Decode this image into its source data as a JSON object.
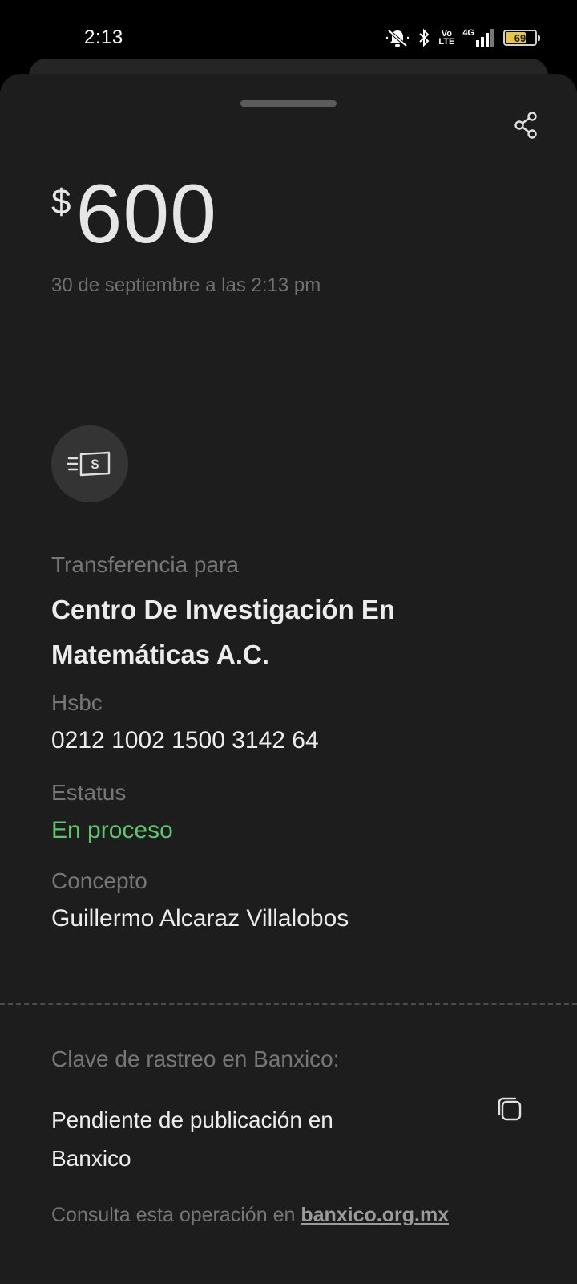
{
  "status_bar": {
    "time": "2:13",
    "network_top": "Vo",
    "network_bottom": "LTE",
    "network_type": "4G",
    "battery_level": "69",
    "icons": [
      "mute-icon",
      "bluetooth-icon",
      "volte-icon",
      "signal-icon",
      "battery-icon"
    ]
  },
  "transaction": {
    "currency_symbol": "$",
    "amount": "600",
    "date": "30 de septiembre a las 2:13 pm",
    "type_icon": "money-transfer-icon",
    "recipient_label": "Transferencia para",
    "recipient_name": "Centro De Investigación En Matemáticas A.C.",
    "bank_label": "Hsbc",
    "account_number": "0212 1002 1500 3142 64",
    "status_label": "Estatus",
    "status_value": "En proceso",
    "concept_label": "Concepto",
    "concept_value": "Guillermo Alcaraz Villalobos"
  },
  "tracking": {
    "label": "Clave de rastreo en Banxico:",
    "value": "Pendiente de publicación en Banxico",
    "footer_text": "Consulta esta operación en ",
    "footer_link": "banxico.org.mx"
  },
  "colors": {
    "background": "#1c1d1c",
    "status_ok": "#5ec66d",
    "muted_text": "#757675",
    "battery": "#e6c64a"
  }
}
